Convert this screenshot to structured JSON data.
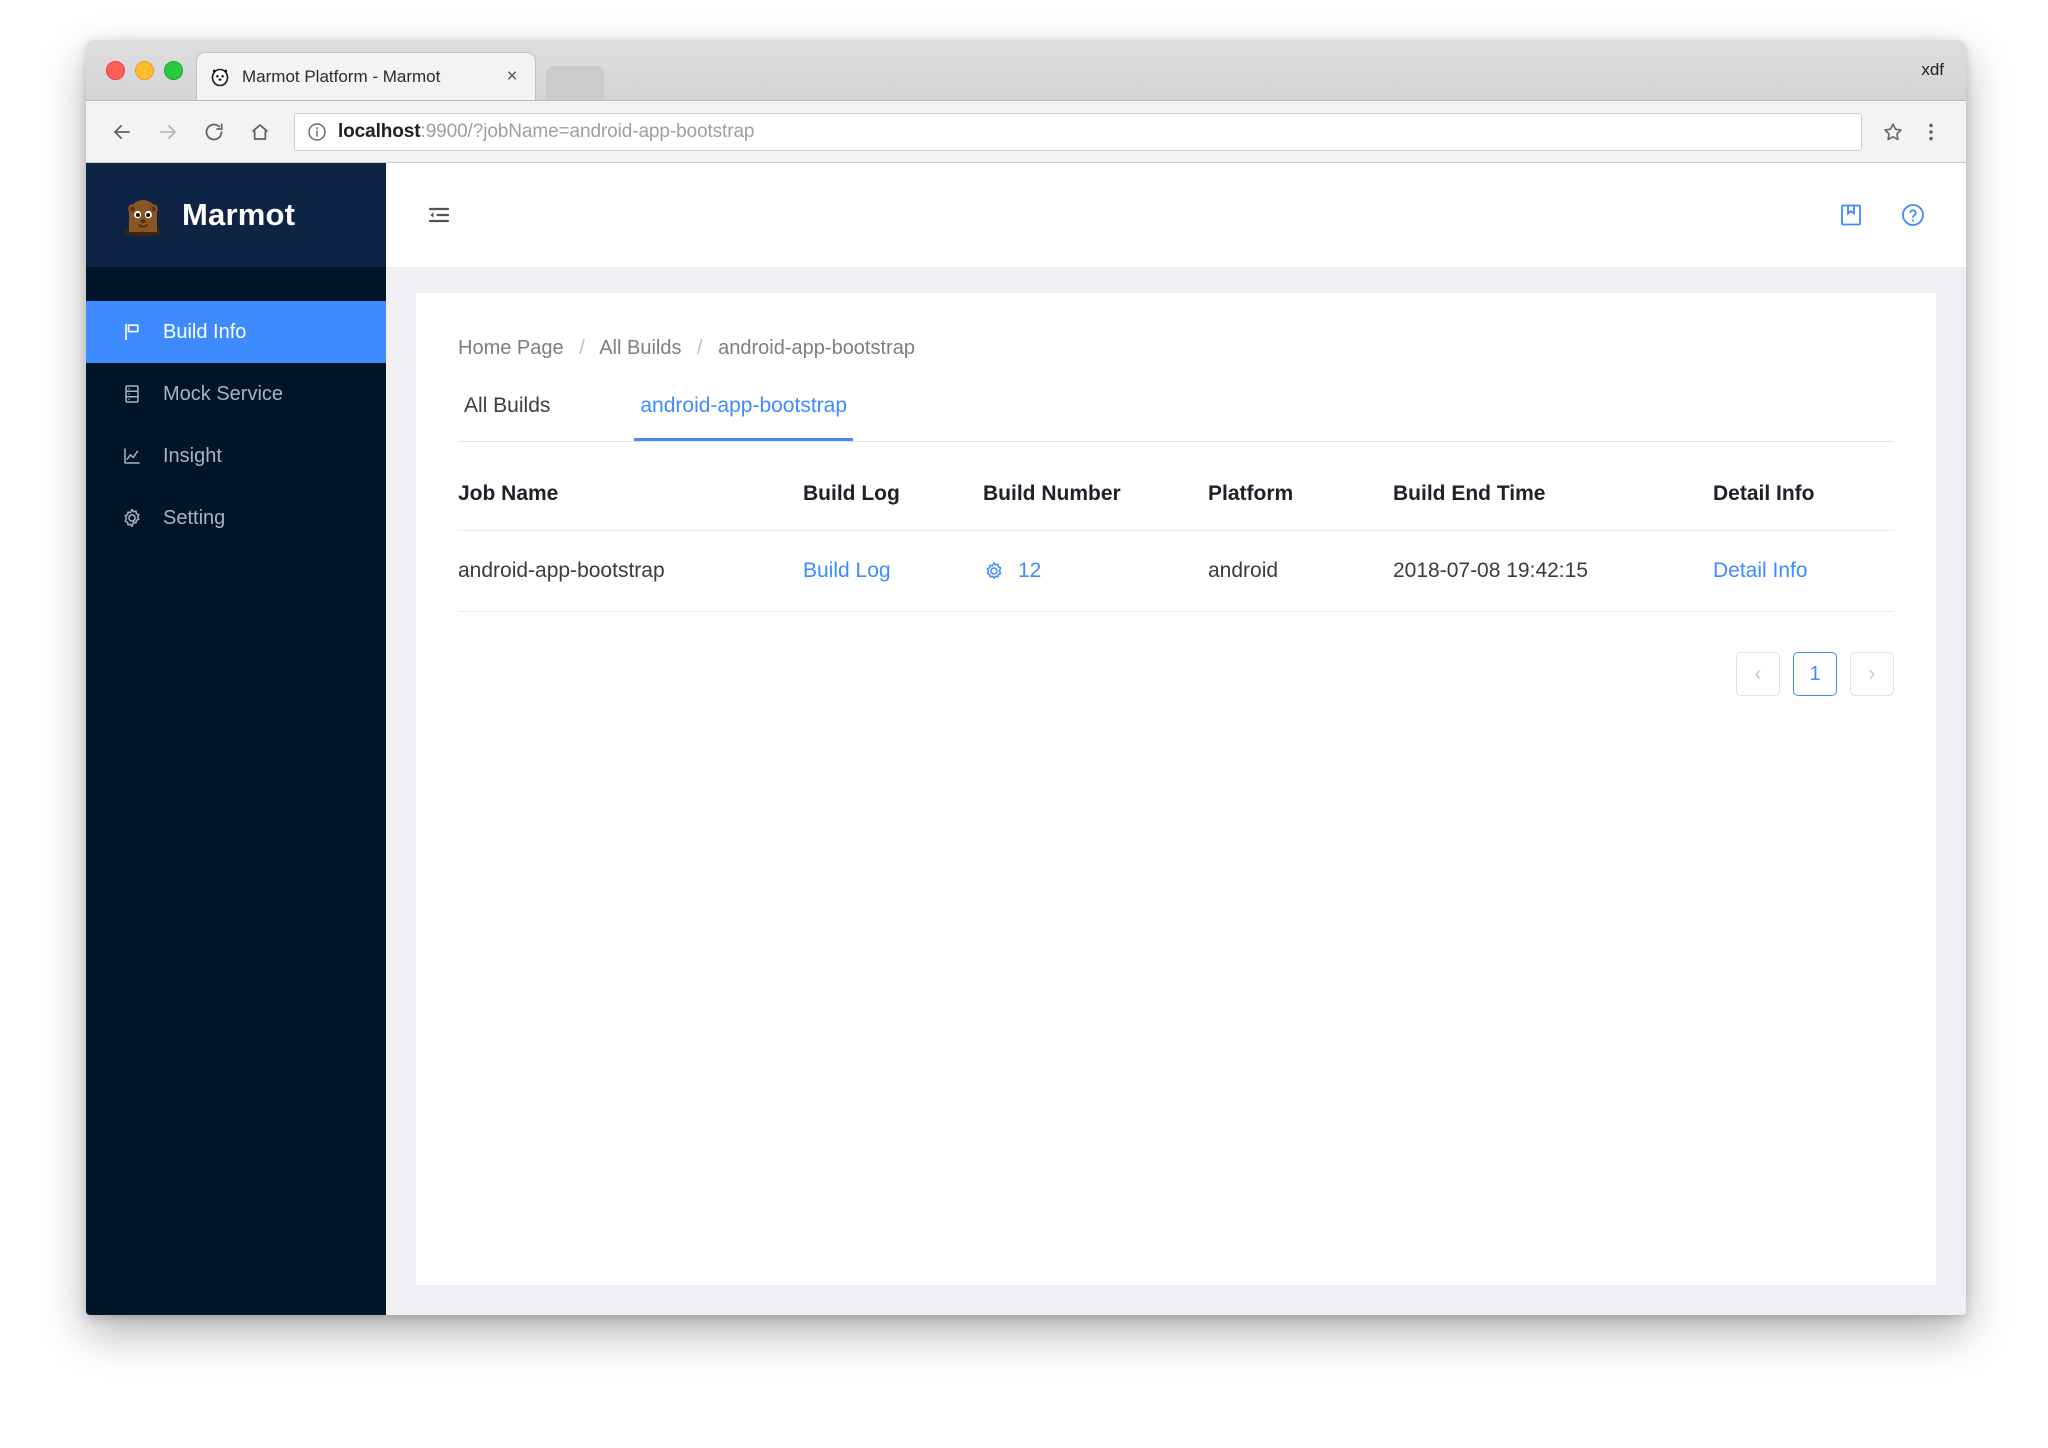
{
  "browser": {
    "tab_title": "Marmot Platform - Marmot",
    "tab_close_label": "×",
    "window_user_label": "xdf",
    "url_host": "localhost",
    "url_rest": ":9900/?jobName=android-app-bootstrap"
  },
  "sidebar": {
    "brand": "Marmot",
    "items": [
      {
        "label": "Build Info",
        "icon": "flag-icon",
        "active": true
      },
      {
        "label": "Mock Service",
        "icon": "server-icon",
        "active": false
      },
      {
        "label": "Insight",
        "icon": "chart-icon",
        "active": false
      },
      {
        "label": "Setting",
        "icon": "gear-icon",
        "active": false
      }
    ]
  },
  "appbar": {
    "fold_icon": "menu-fold-icon",
    "book_icon": "book-icon",
    "help_icon": "question-circle-icon"
  },
  "breadcrumb": {
    "items": [
      "Home Page",
      "All Builds",
      "android-app-bootstrap"
    ],
    "separator": "/"
  },
  "tabs": [
    {
      "label": "All Builds",
      "active": false
    },
    {
      "label": "android-app-bootstrap",
      "active": true
    }
  ],
  "table": {
    "headers": [
      "Job Name",
      "Build Log",
      "Build Number",
      "Platform",
      "Build End Time",
      "Detail Info"
    ],
    "rows": [
      {
        "job_name": "android-app-bootstrap",
        "build_log": "Build Log",
        "build_number": "12",
        "build_number_icon": "gear-icon",
        "platform": "android",
        "build_end_time": "2018-07-08 19:42:15",
        "detail_info": "Detail Info"
      }
    ]
  },
  "pagination": {
    "prev_label": "‹",
    "pages": [
      "1"
    ],
    "next_label": "›",
    "current": "1"
  },
  "colors": {
    "accent": "#3d8bff",
    "sidebar_bg": "#001529",
    "brand_bg": "#0d2444",
    "content_bg": "#f0f0f4"
  }
}
